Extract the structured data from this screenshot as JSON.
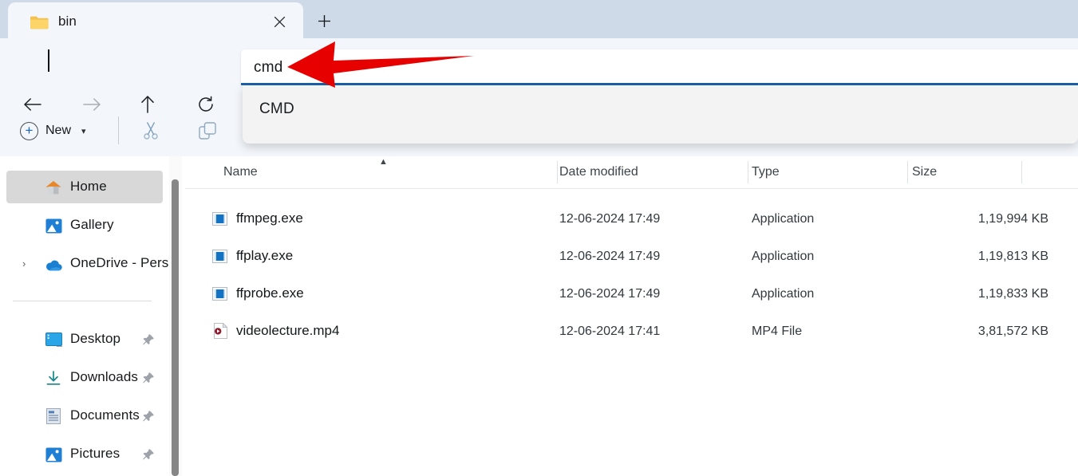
{
  "window": {
    "tab": {
      "title": "bin",
      "folder_icon": "folder-icon",
      "close_icon": "close-icon"
    },
    "new_tab_icon": "plus-icon"
  },
  "navigation": {
    "back": {
      "icon": "back-arrow-icon",
      "enabled": true
    },
    "forward": {
      "icon": "forward-arrow-icon",
      "enabled": false
    },
    "up": {
      "icon": "up-arrow-icon",
      "enabled": true
    },
    "refresh": {
      "icon": "refresh-icon",
      "enabled": true
    }
  },
  "toolbar": {
    "new_label": "New",
    "new_icon": "plus-circle-icon",
    "new_chevron": "chevron-down-icon",
    "cut_icon": "scissors-icon",
    "copy_icon": "copy-icon"
  },
  "address_bar": {
    "value": "cmd",
    "caret_visible": true,
    "underline_color": "#1a5fa8"
  },
  "suggestions": {
    "items": [
      {
        "label": "CMD"
      }
    ]
  },
  "sidebar": {
    "items": [
      {
        "label": "Home",
        "icon": "home-icon",
        "selected": true,
        "pinned": false,
        "expandable": false
      },
      {
        "label": "Gallery",
        "icon": "gallery-icon",
        "selected": false,
        "pinned": false,
        "expandable": false
      },
      {
        "label": "OneDrive - Perso",
        "icon": "onedrive-icon",
        "selected": false,
        "pinned": false,
        "expandable": true
      },
      {
        "label": "Desktop",
        "icon": "desktop-icon",
        "selected": false,
        "pinned": true,
        "expandable": false
      },
      {
        "label": "Downloads",
        "icon": "downloads-icon",
        "selected": false,
        "pinned": true,
        "expandable": false
      },
      {
        "label": "Documents",
        "icon": "documents-icon",
        "selected": false,
        "pinned": true,
        "expandable": false
      },
      {
        "label": "Pictures",
        "icon": "pictures-icon",
        "selected": false,
        "pinned": true,
        "expandable": false
      }
    ]
  },
  "file_list": {
    "columns": [
      "Name",
      "Date modified",
      "Type",
      "Size"
    ],
    "sort_column": "Name",
    "sort_direction": "ascending",
    "rows": [
      {
        "name": "ffmpeg.exe",
        "icon": "application-icon",
        "date": "12-06-2024 17:49",
        "type": "Application",
        "size": "1,19,994 KB"
      },
      {
        "name": "ffplay.exe",
        "icon": "application-icon",
        "date": "12-06-2024 17:49",
        "type": "Application",
        "size": "1,19,813 KB"
      },
      {
        "name": "ffprobe.exe",
        "icon": "application-icon",
        "date": "12-06-2024 17:49",
        "type": "Application",
        "size": "1,19,833 KB"
      },
      {
        "name": "videolecture.mp4",
        "icon": "video-file-icon",
        "date": "12-06-2024 17:41",
        "type": "MP4 File",
        "size": "3,81,572 KB"
      }
    ]
  },
  "annotation": {
    "arrow": {
      "icon": "red-arrow-left-icon",
      "color": "#e60000",
      "points_to": "address-bar"
    }
  }
}
